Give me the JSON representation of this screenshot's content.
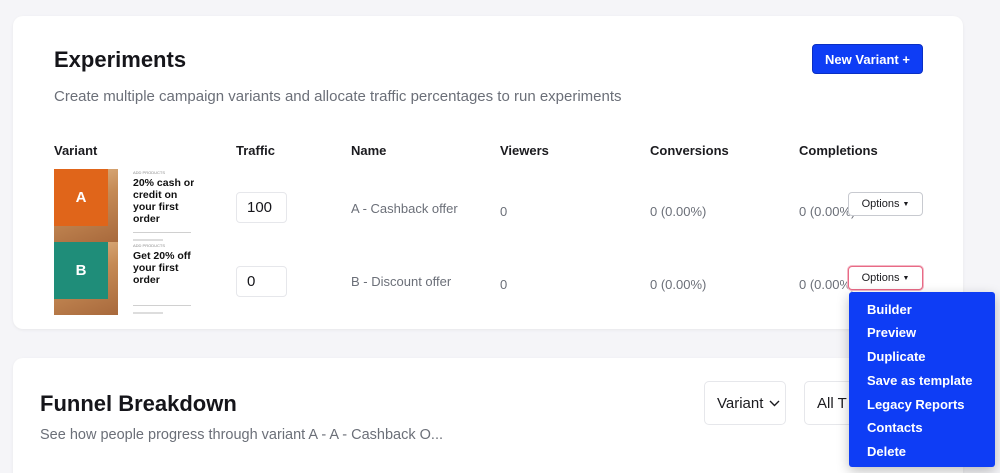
{
  "experiments": {
    "title": "Experiments",
    "subtitle": "Create multiple campaign variants and allocate traffic percentages to run experiments",
    "new_variant_label": "New Variant +",
    "columns": [
      "Variant",
      "Traffic",
      "Name",
      "Viewers",
      "Conversions",
      "Completions"
    ],
    "rows": [
      {
        "letter": "A",
        "thumb_small": "ADD PRODUCTS",
        "thumb_headline": "20% cash or credit on your first order",
        "accent": "#e0651a",
        "traffic": "100",
        "name": "A - Cashback offer",
        "viewers": "0",
        "conversions": "0 (0.00%)",
        "completions": "0 (0.00%)",
        "options_label": "Options"
      },
      {
        "letter": "B",
        "thumb_small": "ADD PRODUCTS",
        "thumb_headline": "Get 20% off your first order",
        "accent": "#1f8d79",
        "traffic": "0",
        "name": "B - Discount offer",
        "viewers": "0",
        "conversions": "0 (0.00%)",
        "completions": "0 (0.00%)",
        "options_label": "Options"
      }
    ]
  },
  "options_menu": {
    "items": [
      "Builder",
      "Preview",
      "Duplicate",
      "Save as template",
      "Legacy Reports",
      "Contacts",
      "Delete"
    ]
  },
  "funnel": {
    "title": "Funnel Breakdown",
    "subtitle": "See how people progress through variant A - A - Cashback O...",
    "variant_select": "Variant",
    "all_select": "All T"
  },
  "colors": {
    "primary": "#0e3df5",
    "variant_a": "#e0651a",
    "variant_b": "#1f8d79"
  }
}
